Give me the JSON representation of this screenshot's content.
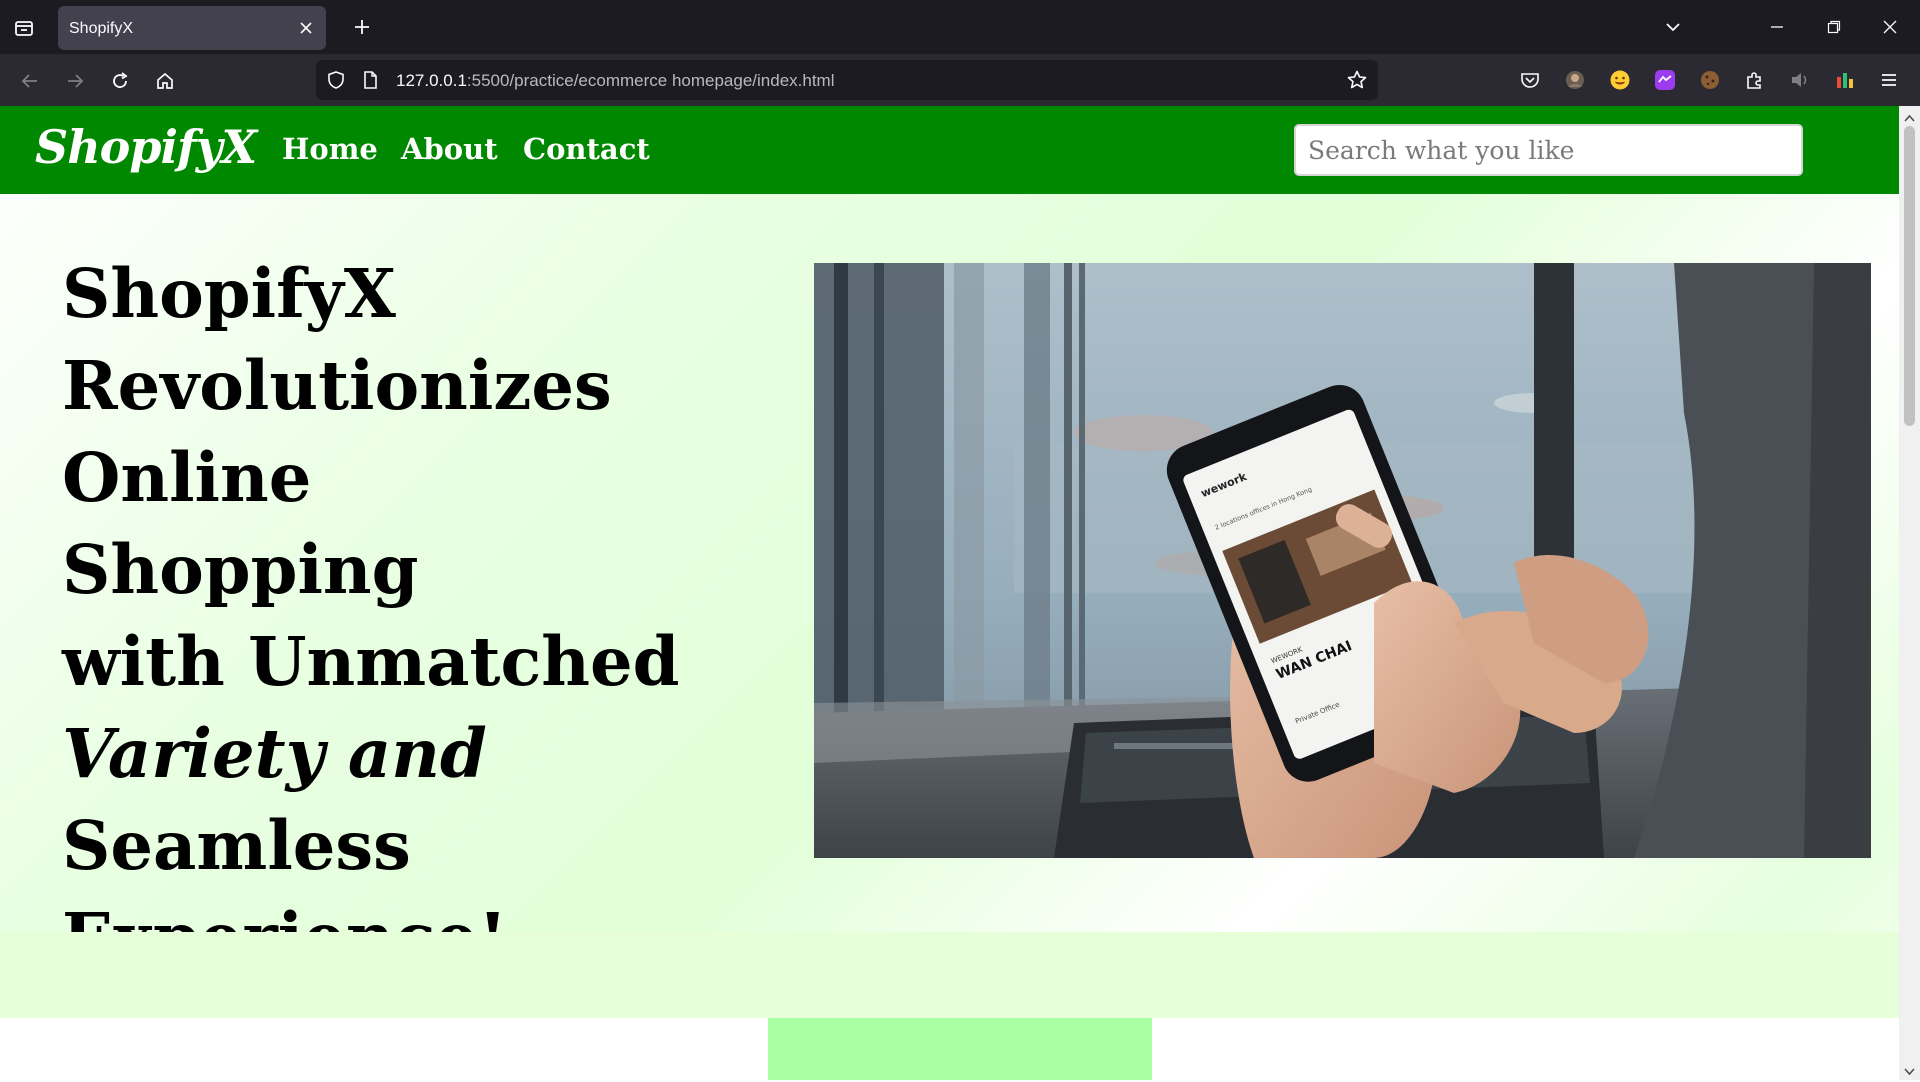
{
  "browser": {
    "tab_title": "ShopifyX",
    "url_host": "127.0.0.1",
    "url_rest": ":5500/practice/ecommerce homepage/index.html"
  },
  "site": {
    "brand": "ShopifyX",
    "nav": [
      {
        "label": "Home"
      },
      {
        "label": "About"
      },
      {
        "label": "Contact"
      }
    ],
    "search_placeholder": "Search what you like"
  },
  "hero": {
    "lines": [
      "ShopifyX",
      "Revolutionizes",
      "Online Shopping",
      "with Unmatched",
      "Variety and",
      "Seamless",
      "Experience!"
    ],
    "image_alt": "Person holding a smartphone showing a WeWork Wan Chai listing in front of a window"
  },
  "phone_screen": {
    "logo": "wework",
    "heading": "2 locations offices in Hong Kong",
    "card_small": "WEWORK",
    "card_title": "WAN CHAI",
    "card_detail": "Private Office"
  },
  "colors": {
    "header_green": "#008800",
    "band_green": "#e6ffd8",
    "block_green": "#aaffa3",
    "chrome_dark": "#1c1b22"
  }
}
